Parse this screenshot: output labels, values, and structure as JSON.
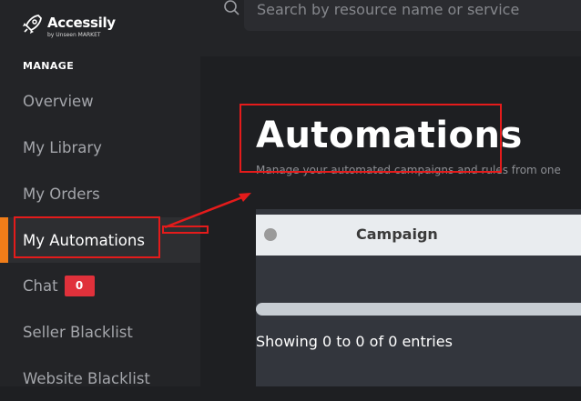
{
  "app": {
    "name": "Accessily",
    "tagline": "by Unseen MARKET"
  },
  "sidebar": {
    "section_label": "MANAGE",
    "items": [
      {
        "label": "Overview"
      },
      {
        "label": "My Library"
      },
      {
        "label": "My Orders"
      },
      {
        "label": "My Automations"
      },
      {
        "label": "Chat",
        "badge": "0"
      },
      {
        "label": "Seller Blacklist"
      },
      {
        "label": "Website Blacklist"
      }
    ],
    "active_item": "My Automations"
  },
  "search": {
    "placeholder": "Search by resource name or service"
  },
  "main": {
    "title": "Automations",
    "subtitle": "Manage your automated campaigns and rules from one"
  },
  "table": {
    "columns": [
      "Campaign"
    ],
    "info": "Showing 0 to 0 of 0 entries"
  },
  "colors": {
    "accent": "#f07d19",
    "badge": "#e0313b",
    "annotation": "#e41b1b"
  },
  "icons": [
    "rocket-logo-icon",
    "search-icon",
    "sort-dot-icon"
  ]
}
